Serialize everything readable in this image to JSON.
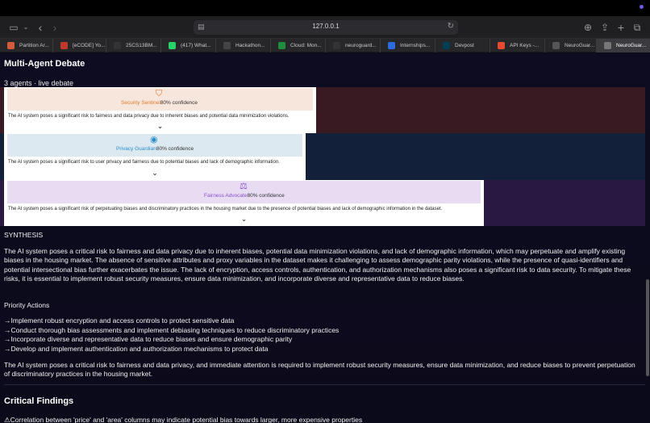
{
  "browser": {
    "url": "127.0.0.1",
    "tabs": [
      {
        "label": "Partition Ar...",
        "color": "#d65b3a"
      },
      {
        "label": "[eCODE] Yo...",
        "color": "#c0392b"
      },
      {
        "label": "25CS13BM...",
        "color": "#333333"
      },
      {
        "label": "(417) What...",
        "color": "#25d366"
      },
      {
        "label": "Hackathon...",
        "color": "#444444"
      },
      {
        "label": "Cloud: Mon...",
        "color": "#1e8e3e"
      },
      {
        "label": "neuroguard...",
        "color": "#333333"
      },
      {
        "label": "Internships...",
        "color": "#2d6cdf"
      },
      {
        "label": "Devpost",
        "color": "#003e54"
      },
      {
        "label": "API Keys -...",
        "color": "#e54b30"
      },
      {
        "label": "NeuroGuar...",
        "color": "#555555"
      },
      {
        "label": "NeuroGuar...",
        "color": "#777777"
      }
    ]
  },
  "debate": {
    "title": "Multi-Agent Debate",
    "meta": "3 agents · live debate",
    "agents": [
      {
        "name": "Security Sentinel",
        "confidence": "80% confidence",
        "text": "The AI system poses a significant risk to fairness and data privacy due to inherent biases and potential data minimization violations.",
        "color": "#e07b2a",
        "icon": "⛉"
      },
      {
        "name": "Privacy Guardian",
        "confidence": "80% confidence",
        "text": "The AI system poses a significant risk to user privacy and fairness due to potential biases and lack of demographic information.",
        "color": "#2a8fc9",
        "icon": "👁"
      },
      {
        "name": "Fairness Advocate",
        "confidence": "80% confidence",
        "text": "The AI system poses a significant risk of perpetuating biases and discriminatory practices in the housing market due to the presence of potential biases and lack of demographic information in the dataset.",
        "color": "#8a4fd0",
        "icon": "⚖"
      }
    ]
  },
  "synthesis": {
    "label": "SYNTHESIS",
    "text": "The AI system poses a critical risk to fairness and data privacy due to inherent biases, potential data minimization violations, and lack of demographic information, which may perpetuate and amplify existing biases in the housing market. The absence of sensitive attributes and proxy variables in the dataset makes it challenging to assess demographic parity violations, while the presence of quasi-identifiers and potential intersectional bias further exacerbates the issue. The lack of encryption, access controls, authentication, and authorization mechanisms also poses a significant risk to data security. To mitigate these risks, it is essential to implement robust security measures, ensure data minimization, and incorporate diverse and representative data to reduce biases.",
    "priority_label": "Priority Actions",
    "actions": [
      "→Implement robust encryption and access controls to protect sensitive data",
      "→Conduct thorough bias assessments and implement debiasing techniques to reduce discriminatory practices",
      "→Incorporate diverse and representative data to reduce biases and ensure demographic parity",
      "→Develop and implement authentication and authorization mechanisms to protect data"
    ],
    "conclusion": "The AI system poses a critical risk to fairness and data privacy, and immediate attention is required to implement robust security measures, ensure data minimization, and reduce biases to prevent perpetuation of discriminatory practices in the housing market."
  },
  "critical": {
    "title": "Critical Findings",
    "first_item": "Correlation between 'price' and 'area' columns may indicate potential bias towards larger, more expensive properties"
  }
}
